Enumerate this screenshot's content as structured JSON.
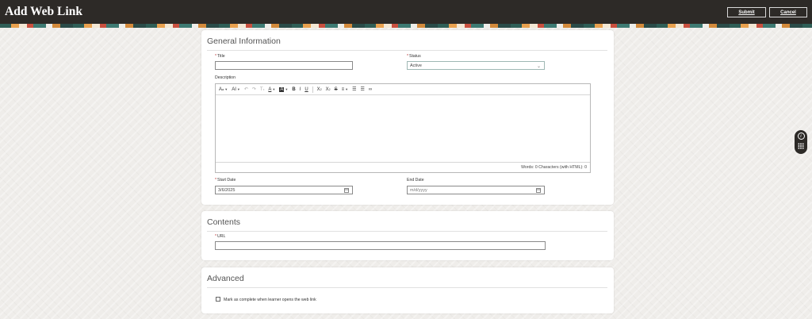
{
  "header": {
    "title": "Add Web Link",
    "submit_label": "Submit",
    "cancel_label": "Cancel"
  },
  "general": {
    "section_title": "General Information",
    "title_label": "Title",
    "title_value": "",
    "status_label": "Status",
    "status_value": "Active",
    "description_label": "Description",
    "editor_status": "Words: 0 Characters (with HTML): 0",
    "start_date_label": "Start Date",
    "start_date_value": "3/6/2025",
    "end_date_label": "End Date",
    "end_date_placeholder": "m/d/yyyy",
    "toolbar": [
      "font-size-icon",
      "font-family-icon",
      "undo-icon",
      "redo-icon",
      "clear-format-icon",
      "font-color-icon",
      "highlight-color-icon",
      "bold-icon",
      "italic-icon",
      "underline-icon",
      "subscript-icon",
      "superscript-icon",
      "strikethrough-icon",
      "align-icon",
      "numbered-list-icon",
      "bullet-list-icon",
      "link-icon"
    ]
  },
  "contents": {
    "section_title": "Contents",
    "url_label": "URL",
    "url_value": ""
  },
  "advanced": {
    "section_title": "Advanced",
    "mark_complete_label": "Mark as complete when learner opens the web link",
    "mark_complete_checked": false
  },
  "colors": {
    "header_bg": "#2d2a27",
    "required_asterisk": "#b33333",
    "page_bg": "#efedea"
  }
}
